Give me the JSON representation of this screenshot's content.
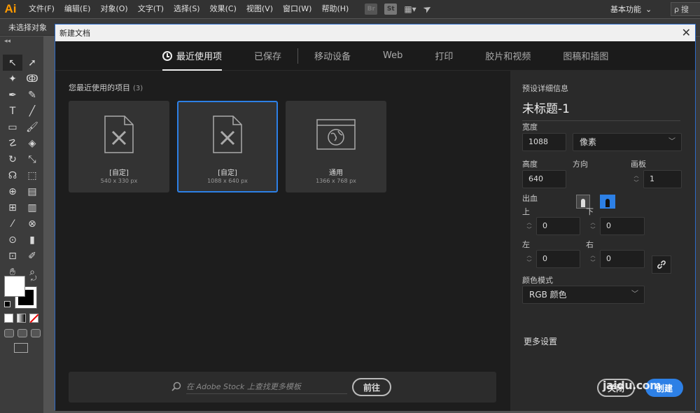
{
  "menubar": {
    "logo": "Ai",
    "menus": [
      "文件(F)",
      "编辑(E)",
      "对象(O)",
      "文字(T)",
      "选择(S)",
      "效果(C)",
      "视图(V)",
      "窗口(W)",
      "帮助(H)"
    ],
    "app_icons": [
      "Br",
      "St"
    ],
    "workspace": "基本功能",
    "search_glyph": "ρ",
    "search_text": "搜"
  },
  "controlbar": {
    "no_selection": "未选择对象"
  },
  "toolbar": {
    "collapse": "◂◂"
  },
  "dialog": {
    "title": "新建文档",
    "close_glyph": "✕",
    "tabs": [
      {
        "label": "最近使用项"
      },
      {
        "label": "已保存"
      },
      {
        "label": "移动设备"
      },
      {
        "label": "Web"
      },
      {
        "label": "打印"
      },
      {
        "label": "胶片和视频"
      },
      {
        "label": "图稿和插图"
      }
    ],
    "recent": {
      "heading": "您最近使用的项目",
      "count": "(3)",
      "presets": [
        {
          "name": "[自定]",
          "size": "540 x 330 px"
        },
        {
          "name": "[自定]",
          "size": "1088 x 640 px"
        },
        {
          "name": "通用",
          "size": "1366 x 768 px"
        }
      ]
    },
    "stock": {
      "placeholder": "在 Adobe Stock 上查找更多模板",
      "go_label": "前往"
    },
    "details": {
      "section_label": "预设详细信息",
      "title": "未标题-1",
      "width_label": "宽度",
      "width_value": "1088",
      "unit": "像素",
      "height_label": "高度",
      "height_value": "640",
      "orientation_label": "方向",
      "artboards_label": "画板",
      "artboards_value": "1",
      "bleed_label": "出血",
      "top_label": "上",
      "top_value": "0",
      "bottom_label": "下",
      "bottom_value": "0",
      "left_label": "左",
      "left_value": "0",
      "right_label": "右",
      "right_value": "0",
      "color_mode_label": "颜色模式",
      "color_mode": "RGB 颜色",
      "more_settings": "更多设置",
      "close_label": "关闭",
      "create_label": "创建",
      "watermark": "jaidu.com"
    },
    "accent_color": "#2d80e6"
  }
}
